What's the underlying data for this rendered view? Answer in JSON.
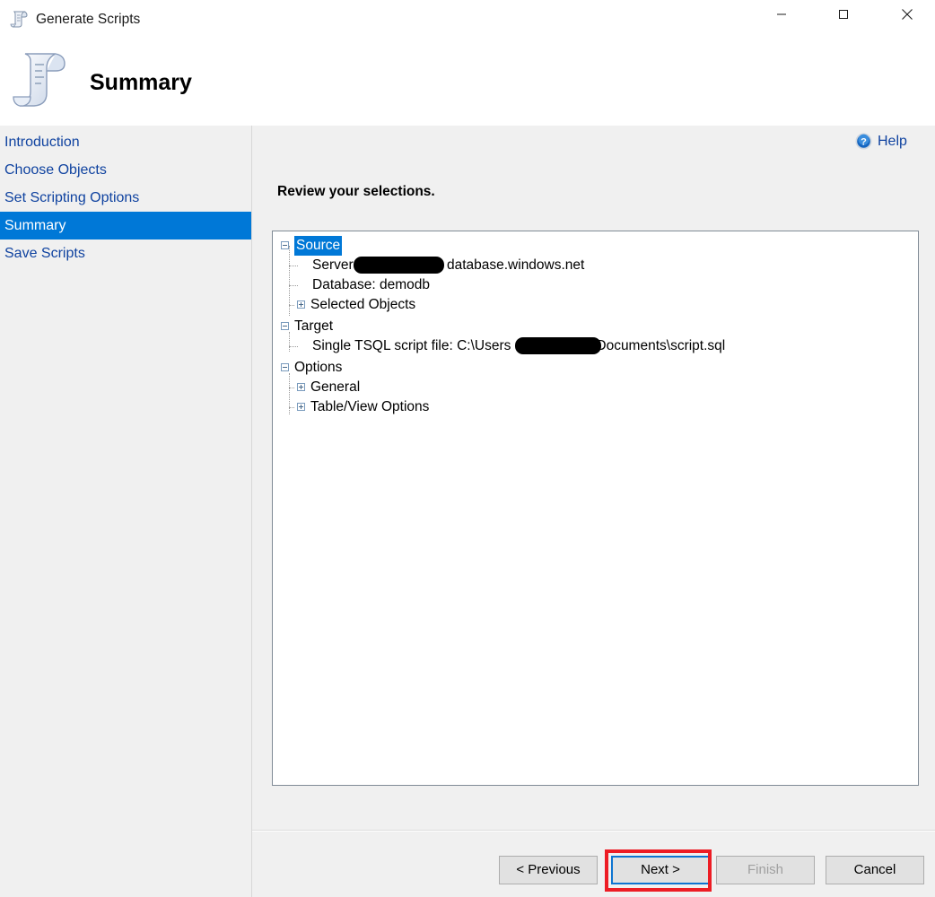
{
  "window": {
    "title": "Generate Scripts",
    "icon": "script-scroll-icon",
    "controls": {
      "minimize": "minimize-icon",
      "maximize": "maximize-icon",
      "close": "close-icon"
    }
  },
  "header": {
    "title": "Summary",
    "icon": "script-scroll-icon-large"
  },
  "sidebar": {
    "items": [
      {
        "label": "Introduction",
        "selected": false
      },
      {
        "label": "Choose Objects",
        "selected": false
      },
      {
        "label": "Set Scripting Options",
        "selected": false
      },
      {
        "label": "Summary",
        "selected": true
      },
      {
        "label": "Save Scripts",
        "selected": false
      }
    ]
  },
  "content": {
    "help_label": "Help",
    "help_icon": "help-question-icon",
    "instruction": "Review your selections."
  },
  "tree": {
    "nodes": [
      {
        "label": "Source",
        "state": "expanded",
        "selected": true,
        "level": 0
      },
      {
        "label": "Server: database.windows.net",
        "state": "leaf",
        "selected": false,
        "level": 1
      },
      {
        "label": "Database: demodb",
        "state": "leaf",
        "selected": false,
        "level": 1
      },
      {
        "label": "Selected Objects",
        "state": "collapsed",
        "selected": false,
        "level": 1
      },
      {
        "label": "Target",
        "state": "expanded",
        "selected": false,
        "level": 0
      },
      {
        "label": "Single TSQL script file: C:\\Users\\Documents\\script.sql",
        "state": "leaf",
        "selected": false,
        "level": 1
      },
      {
        "label": "Options",
        "state": "expanded",
        "selected": false,
        "level": 0
      },
      {
        "label": "General",
        "state": "collapsed",
        "selected": false,
        "level": 1
      },
      {
        "label": "Table/View Options",
        "state": "collapsed",
        "selected": false,
        "level": 1
      }
    ],
    "server_line": {
      "prefix": "Server:",
      "suffix": "database.windows.net",
      "redacted": true
    },
    "database_line": "Database: demodb",
    "selected_objects_line": "Selected Objects",
    "target_line": "Target",
    "script_line": {
      "prefix": "Single TSQL script file: C:\\Users",
      "suffix": "Documents\\script.sql",
      "redacted": true
    },
    "options_line": "Options",
    "general_line": "General",
    "tableview_line": "Table/View Options",
    "source_line": "Source"
  },
  "buttons": {
    "previous": "< Previous",
    "next": "Next >",
    "finish": "Finish",
    "cancel": "Cancel"
  },
  "colors": {
    "accent": "#0078d7",
    "link": "#1043a0",
    "annotation": "#ed1c24",
    "focus": "#0d74d1",
    "panel": "#f0f0f0"
  }
}
